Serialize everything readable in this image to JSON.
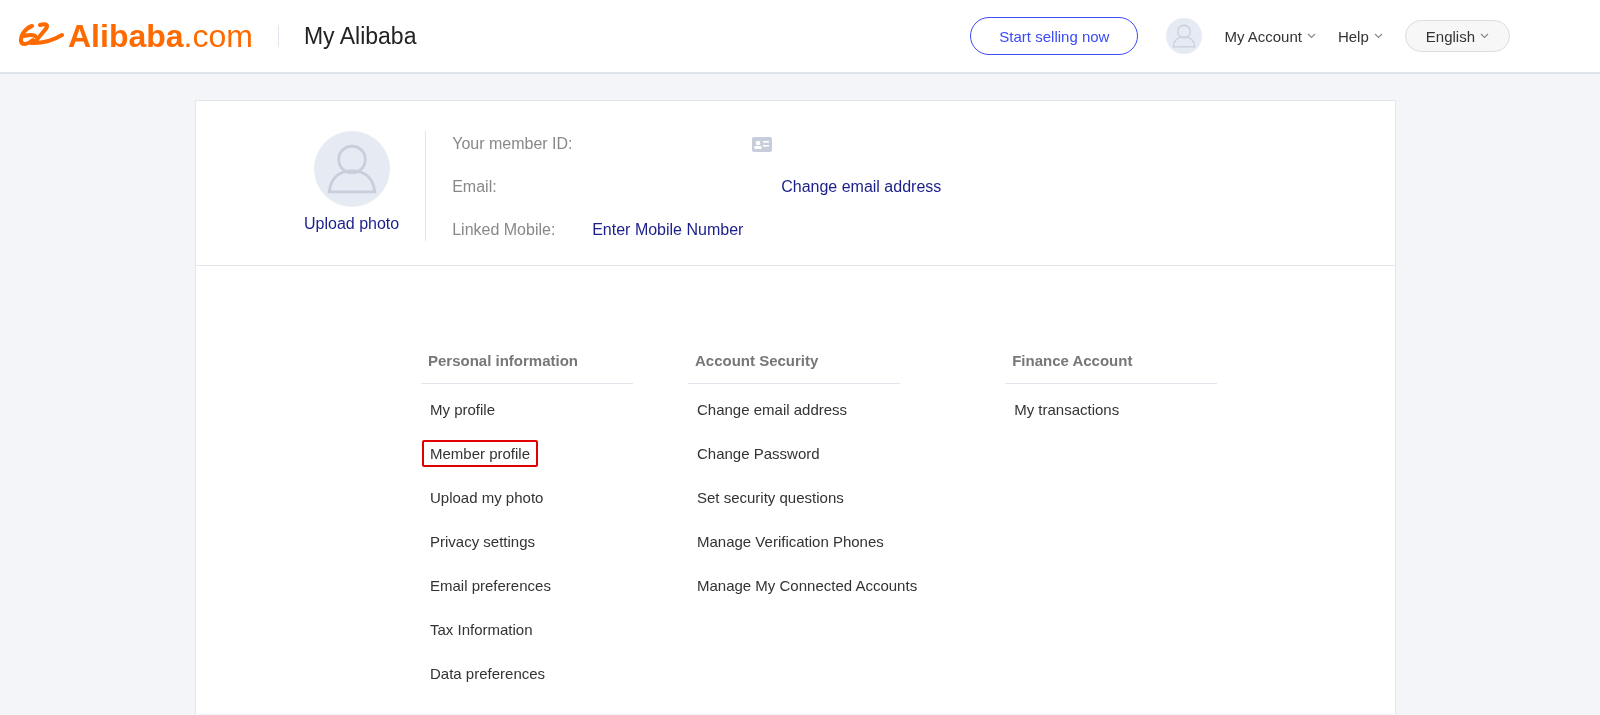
{
  "header": {
    "logo": "**Alibaba**.com",
    "title": "My Alibaba",
    "cta": "Start selling now",
    "menus": [
      {
        "label": "My Account",
        "kind": "link"
      },
      {
        "label": "Help",
        "kind": "link"
      },
      {
        "label": "English",
        "kind": "pill"
      }
    ]
  },
  "profile": {
    "upload": "Upload photo",
    "rows": [
      {
        "label": "Your member ID:",
        "kind": "id"
      },
      {
        "label": "Email:",
        "kind": "action",
        "action": "Change email address"
      },
      {
        "label": "Linked Mobile:",
        "kind": "inline",
        "action": "Enter Mobile Number"
      }
    ]
  },
  "sections": [
    {
      "heading": "Personal information",
      "items": [
        {
          "label": "My profile",
          "annotated": false
        },
        {
          "label": "Member profile",
          "annotated": true
        },
        {
          "label": "Upload my photo",
          "annotated": false
        },
        {
          "label": "Privacy settings",
          "annotated": false
        },
        {
          "label": "Email preferences",
          "annotated": false
        },
        {
          "label": "Tax Information",
          "annotated": false
        },
        {
          "label": "Data preferences",
          "annotated": false
        }
      ]
    },
    {
      "heading": "Account Security",
      "items": [
        {
          "label": "Change email address",
          "annotated": false
        },
        {
          "label": "Change Password",
          "annotated": false
        },
        {
          "label": "Set security questions",
          "annotated": false
        },
        {
          "label": "Manage Verification Phones",
          "annotated": false
        },
        {
          "label": "Manage My Connected Accounts",
          "annotated": false
        }
      ]
    },
    {
      "heading": "Finance Account",
      "items": [
        {
          "label": "My transactions",
          "annotated": false
        }
      ]
    }
  ]
}
